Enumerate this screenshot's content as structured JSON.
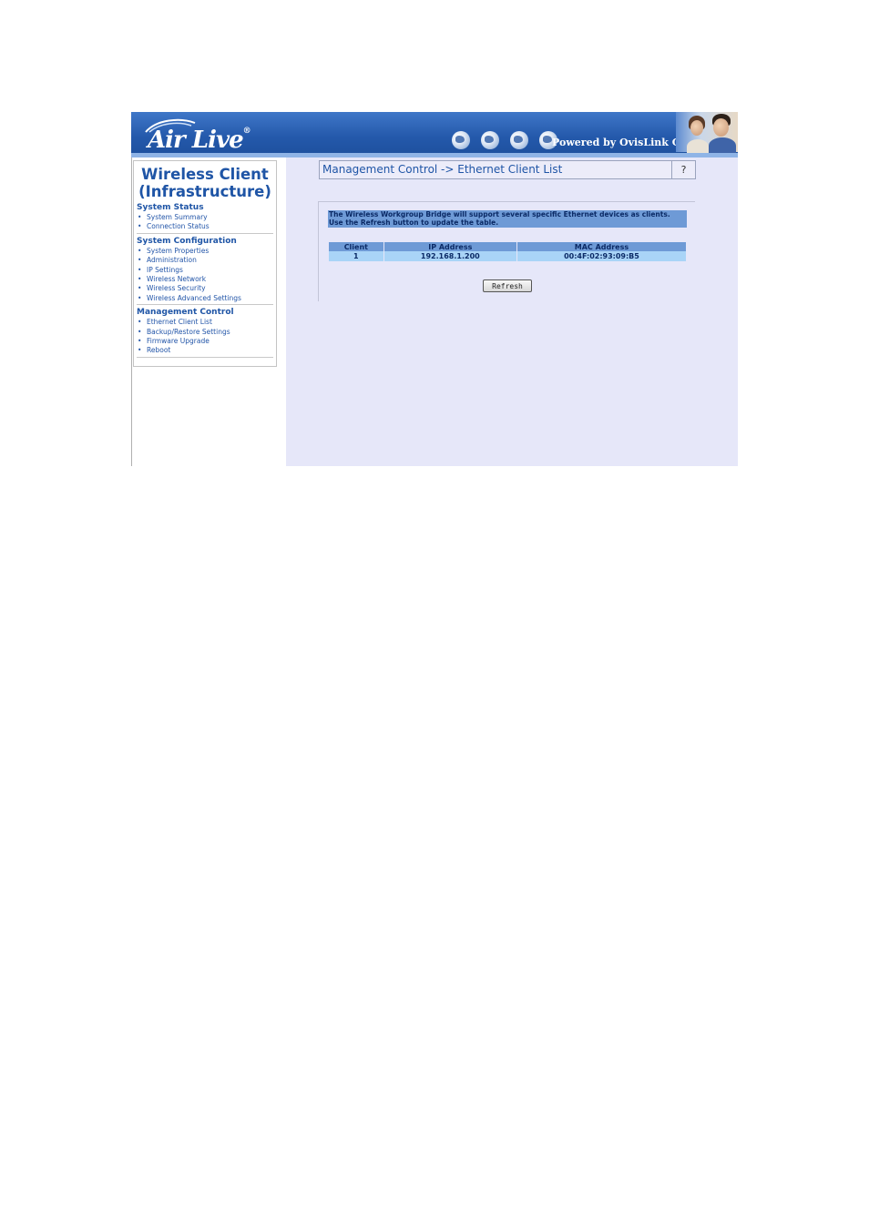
{
  "header": {
    "logo_text": "Air Live",
    "logo_mark": "®",
    "icons": [
      "globe-icon",
      "globe-icon",
      "globe-icon",
      "globe-icon"
    ],
    "powered_by": "Powered by OvisLink Corp."
  },
  "sidebar": {
    "title_line1": "Wireless Client",
    "title_line2": "(Infrastructure)",
    "sections": [
      {
        "label": "System Status",
        "items": [
          "System Summary",
          "Connection Status"
        ]
      },
      {
        "label": "System Configuration",
        "items": [
          "System Properties",
          "Administration",
          "IP Settings",
          "Wireless Network",
          "Wireless Security",
          "Wireless Advanced Settings"
        ]
      },
      {
        "label": "Management Control",
        "items": [
          "Ethernet Client List",
          "Backup/Restore Settings",
          "Firmware Upgrade",
          "Reboot"
        ]
      }
    ]
  },
  "main": {
    "title": "Management Control -> Ethernet Client List",
    "help_label": "?",
    "notice_line1": "The Wireless Workgroup Bridge will support several specific Ethernet devices as clients.",
    "notice_line2": "Use the Refresh button to update the table.",
    "table": {
      "columns": [
        "Client",
        "IP Address",
        "MAC Address"
      ],
      "rows": [
        [
          "1",
          "192.168.1.200",
          "00:4F:02:93:09:B5"
        ]
      ]
    },
    "refresh_label": "Refresh"
  },
  "colors": {
    "header_blue": "#2459ab",
    "content_bg": "#e6e7f9",
    "nav_text": "#1f55a6",
    "table_header": "#6e9ad6",
    "table_row": "#a9d4f7"
  }
}
